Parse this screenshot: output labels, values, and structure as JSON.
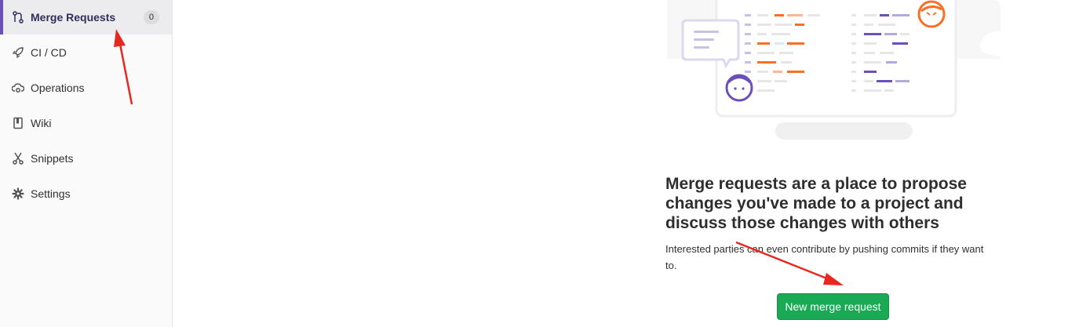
{
  "sidebar": {
    "items": [
      {
        "label": "Merge Requests",
        "icon": "merge-request-icon",
        "badge": "0",
        "active": true
      },
      {
        "label": "CI / CD",
        "icon": "rocket-icon"
      },
      {
        "label": "Operations",
        "icon": "cloud-gear-icon"
      },
      {
        "label": "Wiki",
        "icon": "book-icon"
      },
      {
        "label": "Snippets",
        "icon": "scissors-icon"
      },
      {
        "label": "Settings",
        "icon": "gear-icon"
      }
    ]
  },
  "empty_state": {
    "title": "Merge requests are a place to propose changes you've made to a project and discuss those changes with others",
    "description": "Interested parties can even contribute by pushing commits if they want to.",
    "new_button_label": "New merge request",
    "illustration": "merge-requests-empty-illustration"
  },
  "colors": {
    "accent": "#6b4fbb",
    "button_green": "#1aaa55",
    "annotation_red": "#e8281f",
    "illustration_orange": "#fc6d26"
  }
}
